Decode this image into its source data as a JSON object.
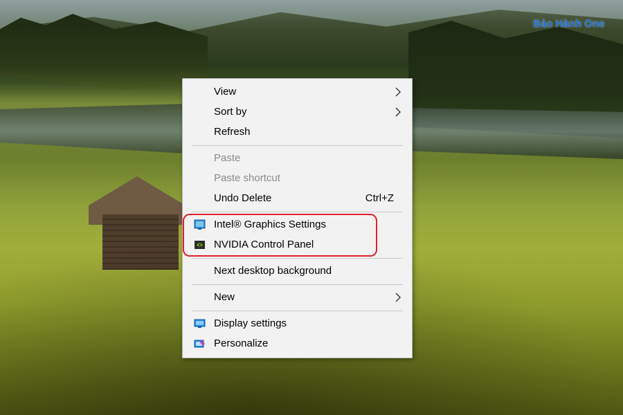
{
  "watermark": {
    "text": "Bảo Hành One",
    "color": "#1f6fd6"
  },
  "context_menu": {
    "items": [
      {
        "label": "View",
        "submenu": true
      },
      {
        "label": "Sort by",
        "submenu": true
      },
      {
        "label": "Refresh"
      },
      {
        "label": "Paste",
        "disabled": true
      },
      {
        "label": "Paste shortcut",
        "disabled": true
      },
      {
        "label": "Undo Delete",
        "shortcut": "Ctrl+Z"
      },
      {
        "label": "Intel® Graphics Settings",
        "icon": "intel-graphics-icon"
      },
      {
        "label": "NVIDIA Control Panel",
        "icon": "nvidia-icon"
      },
      {
        "label": "Next desktop background"
      },
      {
        "label": "New",
        "submenu": true
      },
      {
        "label": "Display settings",
        "icon": "display-settings-icon"
      },
      {
        "label": "Personalize",
        "icon": "personalize-icon"
      }
    ]
  },
  "colors": {
    "menu_background": "#f2f2f2",
    "disabled_text": "#8a8a8a",
    "highlight_outline": "#e0202a"
  }
}
